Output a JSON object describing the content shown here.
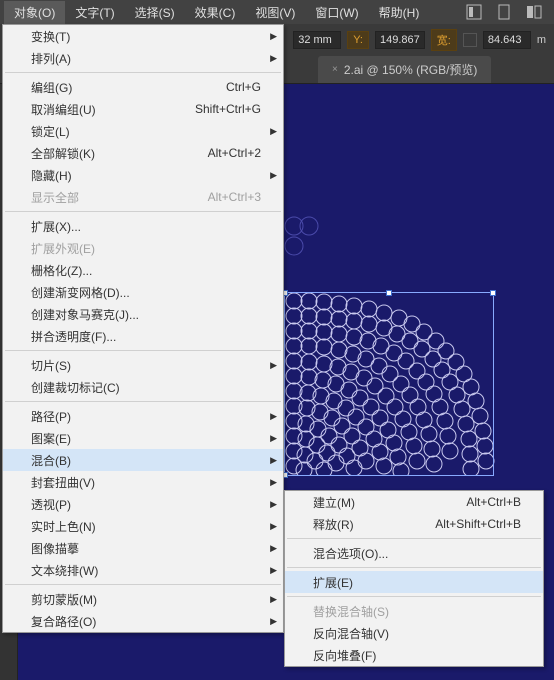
{
  "menubar": {
    "items": [
      "对象(O)",
      "文字(T)",
      "选择(S)",
      "效果(C)",
      "视图(V)",
      "窗口(W)",
      "帮助(H)"
    ]
  },
  "topbar": {
    "field1_value": "32 mm",
    "y_label": "Y:",
    "y_value": "149.867",
    "width_label": "宽:",
    "width_value": "84.643",
    "unit": "m"
  },
  "tab": {
    "label": "2.ai @ 150% (RGB/预览)"
  },
  "menu": {
    "transform": "变换(T)",
    "arrange": "排列(A)",
    "group": "编组(G)",
    "group_sc": "Ctrl+G",
    "ungroup": "取消编组(U)",
    "ungroup_sc": "Shift+Ctrl+G",
    "lock": "锁定(L)",
    "unlock_all": "全部解锁(K)",
    "unlock_all_sc": "Alt+Ctrl+2",
    "hide": "隐藏(H)",
    "show_all": "显示全部",
    "show_all_sc": "Alt+Ctrl+3",
    "expand": "扩展(X)...",
    "expand_appearance": "扩展外观(E)",
    "rasterize": "栅格化(Z)...",
    "gradient_mesh": "创建渐变网格(D)...",
    "mosaic": "创建对象马赛克(J)...",
    "flatten": "拼合透明度(F)...",
    "slice": "切片(S)",
    "trim_marks": "创建裁切标记(C)",
    "path": "路径(P)",
    "pattern": "图案(E)",
    "blend": "混合(B)",
    "envelope": "封套扭曲(V)",
    "perspective": "透视(P)",
    "live_paint": "实时上色(N)",
    "image_trace": "图像描摹",
    "text_wrap": "文本绕排(W)",
    "clipping_mask": "剪切蒙版(M)",
    "compound_path": "复合路径(O)"
  },
  "submenu": {
    "make": "建立(M)",
    "make_sc": "Alt+Ctrl+B",
    "release": "释放(R)",
    "release_sc": "Alt+Shift+Ctrl+B",
    "options": "混合选项(O)...",
    "expand": "扩展(E)",
    "replace_spine": "替换混合轴(S)",
    "reverse_spine": "反向混合轴(V)",
    "reverse_fb": "反向堆叠(F)"
  }
}
